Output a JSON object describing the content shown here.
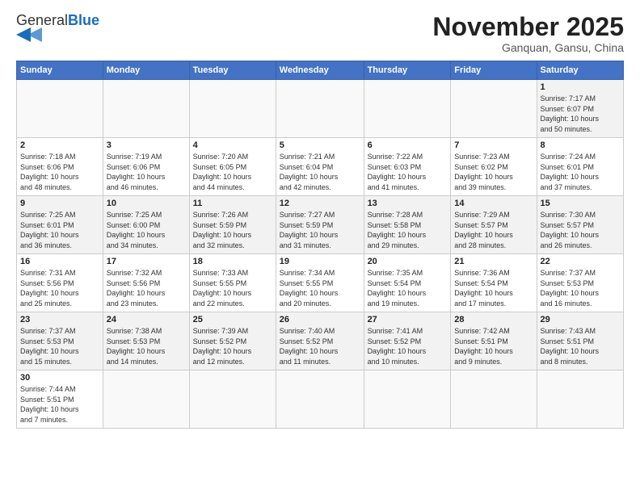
{
  "logo": {
    "text_general": "General",
    "text_blue": "Blue"
  },
  "header": {
    "month": "November 2025",
    "location": "Ganquan, Gansu, China"
  },
  "weekdays": [
    "Sunday",
    "Monday",
    "Tuesday",
    "Wednesday",
    "Thursday",
    "Friday",
    "Saturday"
  ],
  "weeks": [
    [
      {
        "day": "",
        "info": ""
      },
      {
        "day": "",
        "info": ""
      },
      {
        "day": "",
        "info": ""
      },
      {
        "day": "",
        "info": ""
      },
      {
        "day": "",
        "info": ""
      },
      {
        "day": "",
        "info": ""
      },
      {
        "day": "1",
        "info": "Sunrise: 7:17 AM\nSunset: 6:07 PM\nDaylight: 10 hours\nand 50 minutes."
      }
    ],
    [
      {
        "day": "2",
        "info": "Sunrise: 7:18 AM\nSunset: 6:06 PM\nDaylight: 10 hours\nand 48 minutes."
      },
      {
        "day": "3",
        "info": "Sunrise: 7:19 AM\nSunset: 6:06 PM\nDaylight: 10 hours\nand 46 minutes."
      },
      {
        "day": "4",
        "info": "Sunrise: 7:20 AM\nSunset: 6:05 PM\nDaylight: 10 hours\nand 44 minutes."
      },
      {
        "day": "5",
        "info": "Sunrise: 7:21 AM\nSunset: 6:04 PM\nDaylight: 10 hours\nand 42 minutes."
      },
      {
        "day": "6",
        "info": "Sunrise: 7:22 AM\nSunset: 6:03 PM\nDaylight: 10 hours\nand 41 minutes."
      },
      {
        "day": "7",
        "info": "Sunrise: 7:23 AM\nSunset: 6:02 PM\nDaylight: 10 hours\nand 39 minutes."
      },
      {
        "day": "8",
        "info": "Sunrise: 7:24 AM\nSunset: 6:01 PM\nDaylight: 10 hours\nand 37 minutes."
      }
    ],
    [
      {
        "day": "9",
        "info": "Sunrise: 7:25 AM\nSunset: 6:01 PM\nDaylight: 10 hours\nand 36 minutes."
      },
      {
        "day": "10",
        "info": "Sunrise: 7:25 AM\nSunset: 6:00 PM\nDaylight: 10 hours\nand 34 minutes."
      },
      {
        "day": "11",
        "info": "Sunrise: 7:26 AM\nSunset: 5:59 PM\nDaylight: 10 hours\nand 32 minutes."
      },
      {
        "day": "12",
        "info": "Sunrise: 7:27 AM\nSunset: 5:59 PM\nDaylight: 10 hours\nand 31 minutes."
      },
      {
        "day": "13",
        "info": "Sunrise: 7:28 AM\nSunset: 5:58 PM\nDaylight: 10 hours\nand 29 minutes."
      },
      {
        "day": "14",
        "info": "Sunrise: 7:29 AM\nSunset: 5:57 PM\nDaylight: 10 hours\nand 28 minutes."
      },
      {
        "day": "15",
        "info": "Sunrise: 7:30 AM\nSunset: 5:57 PM\nDaylight: 10 hours\nand 26 minutes."
      }
    ],
    [
      {
        "day": "16",
        "info": "Sunrise: 7:31 AM\nSunset: 5:56 PM\nDaylight: 10 hours\nand 25 minutes."
      },
      {
        "day": "17",
        "info": "Sunrise: 7:32 AM\nSunset: 5:56 PM\nDaylight: 10 hours\nand 23 minutes."
      },
      {
        "day": "18",
        "info": "Sunrise: 7:33 AM\nSunset: 5:55 PM\nDaylight: 10 hours\nand 22 minutes."
      },
      {
        "day": "19",
        "info": "Sunrise: 7:34 AM\nSunset: 5:55 PM\nDaylight: 10 hours\nand 20 minutes."
      },
      {
        "day": "20",
        "info": "Sunrise: 7:35 AM\nSunset: 5:54 PM\nDaylight: 10 hours\nand 19 minutes."
      },
      {
        "day": "21",
        "info": "Sunrise: 7:36 AM\nSunset: 5:54 PM\nDaylight: 10 hours\nand 17 minutes."
      },
      {
        "day": "22",
        "info": "Sunrise: 7:37 AM\nSunset: 5:53 PM\nDaylight: 10 hours\nand 16 minutes."
      }
    ],
    [
      {
        "day": "23",
        "info": "Sunrise: 7:37 AM\nSunset: 5:53 PM\nDaylight: 10 hours\nand 15 minutes."
      },
      {
        "day": "24",
        "info": "Sunrise: 7:38 AM\nSunset: 5:53 PM\nDaylight: 10 hours\nand 14 minutes."
      },
      {
        "day": "25",
        "info": "Sunrise: 7:39 AM\nSunset: 5:52 PM\nDaylight: 10 hours\nand 12 minutes."
      },
      {
        "day": "26",
        "info": "Sunrise: 7:40 AM\nSunset: 5:52 PM\nDaylight: 10 hours\nand 11 minutes."
      },
      {
        "day": "27",
        "info": "Sunrise: 7:41 AM\nSunset: 5:52 PM\nDaylight: 10 hours\nand 10 minutes."
      },
      {
        "day": "28",
        "info": "Sunrise: 7:42 AM\nSunset: 5:51 PM\nDaylight: 10 hours\nand 9 minutes."
      },
      {
        "day": "29",
        "info": "Sunrise: 7:43 AM\nSunset: 5:51 PM\nDaylight: 10 hours\nand 8 minutes."
      }
    ],
    [
      {
        "day": "30",
        "info": "Sunrise: 7:44 AM\nSunset: 5:51 PM\nDaylight: 10 hours\nand 7 minutes."
      },
      {
        "day": "",
        "info": ""
      },
      {
        "day": "",
        "info": ""
      },
      {
        "day": "",
        "info": ""
      },
      {
        "day": "",
        "info": ""
      },
      {
        "day": "",
        "info": ""
      },
      {
        "day": "",
        "info": ""
      }
    ]
  ]
}
